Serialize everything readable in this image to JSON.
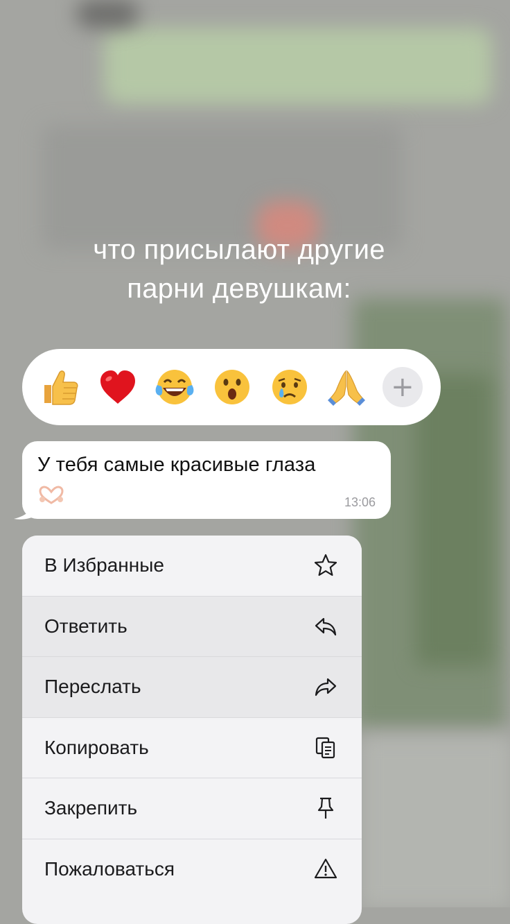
{
  "overlay_caption": {
    "line1": "что присылают другие",
    "line2": "парни девушкам:"
  },
  "reactions": [
    {
      "icon": "thumbs-up-icon",
      "glyph": "👍"
    },
    {
      "icon": "red-heart-icon",
      "glyph": "❤️"
    },
    {
      "icon": "tears-of-joy-icon",
      "glyph": "😂"
    },
    {
      "icon": "surprised-face-icon",
      "glyph": "😮"
    },
    {
      "icon": "crying-face-icon",
      "glyph": "😢"
    },
    {
      "icon": "folded-hands-icon",
      "glyph": "🙏"
    }
  ],
  "reaction_more": {
    "label": "+",
    "icon": "plus-icon"
  },
  "message": {
    "text": "У тебя самые красивые глаза",
    "emoji_icon": "heart-hands-icon",
    "time": "13:06"
  },
  "menu": {
    "items": [
      {
        "label": "В Избранные",
        "icon": "star-icon"
      },
      {
        "label": "Ответить",
        "icon": "reply-icon"
      },
      {
        "label": "Переслать",
        "icon": "forward-icon"
      },
      {
        "label": "Копировать",
        "icon": "copy-icon"
      },
      {
        "label": "Закрепить",
        "icon": "pin-icon"
      },
      {
        "label": "Пожаловаться",
        "icon": "warning-icon"
      }
    ]
  },
  "colors": {
    "menu_background": "#f3f3f5",
    "bubble_background": "#ffffff",
    "caption_text": "#ffffff"
  }
}
